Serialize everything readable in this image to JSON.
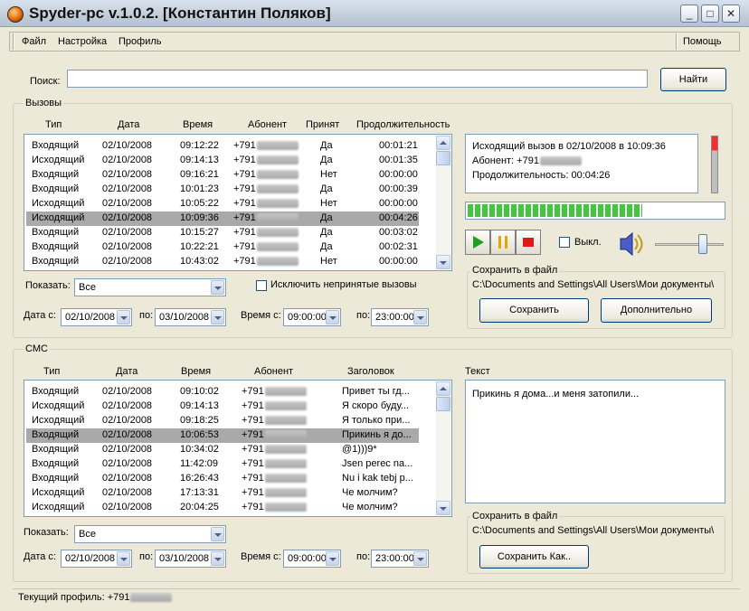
{
  "window": {
    "title": "Spyder-pc v.1.0.2. [Константин Поляков]",
    "minimize": "_",
    "maximize": "□",
    "close": "✕"
  },
  "menu": {
    "file": "Файл",
    "settings": "Настройка",
    "profile": "Профиль",
    "help": "Помощь"
  },
  "search": {
    "label": "Поиск:",
    "value": "",
    "button": "Найти"
  },
  "calls": {
    "group_title": "Вызовы",
    "headers": [
      "Тип",
      "Дата",
      "Время",
      "Абонент",
      "Принят",
      "Продолжительность"
    ],
    "rows": [
      [
        "Входящий",
        "02/10/2008",
        "09:12:22",
        "+791",
        "Да",
        "00:01:21"
      ],
      [
        "Исходящий",
        "02/10/2008",
        "09:14:13",
        "+791",
        "Да",
        "00:01:35"
      ],
      [
        "Входящий",
        "02/10/2008",
        "09:16:21",
        "+791",
        "Нет",
        "00:00:00"
      ],
      [
        "Входящий",
        "02/10/2008",
        "10:01:23",
        "+791",
        "Да",
        "00:00:39"
      ],
      [
        "Исходящий",
        "02/10/2008",
        "10:05:22",
        "+791",
        "Нет",
        "00:00:00"
      ],
      [
        "Исходящий",
        "02/10/2008",
        "10:09:36",
        "+791",
        "Да",
        "00:04:26"
      ],
      [
        "Входящий",
        "02/10/2008",
        "10:15:27",
        "+791",
        "Да",
        "00:03:02"
      ],
      [
        "Входящий",
        "02/10/2008",
        "10:22:21",
        "+791",
        "Да",
        "00:02:31"
      ],
      [
        "Входящий",
        "02/10/2008",
        "10:43:02",
        "+791",
        "Нет",
        "00:00:00"
      ]
    ],
    "selected_index": 5,
    "show_label": "Показать:",
    "show_value": "Все",
    "exclude_label": "Исключить непринятые вызовы",
    "date_from_label": "Дата с:",
    "date_from": "02/10/2008",
    "date_to_label": "по:",
    "date_to": "03/10/2008",
    "time_from_label": "Время с:",
    "time_from": "09:00:00",
    "time_to_label": "по:",
    "time_to": "23:00:00"
  },
  "call_info": {
    "line1": "Исходящий вызов в 02/10/2008 в 10:09:36",
    "line2": "Абонент: +791",
    "line3": "Продолжительность: 00:04:26"
  },
  "player": {
    "progress_fraction": 0.68,
    "volume_fraction": 0.72,
    "mute_label": "Выкл.",
    "save_group_title": "Сохранить в файл",
    "save_path": "C:\\Documents and Settings\\All Users\\Мои документы\\",
    "save_button": "Сохранить",
    "extra_button": "Дополнительно"
  },
  "sms": {
    "group_title": "СМС",
    "headers": [
      "Тип",
      "Дата",
      "Время",
      "Абонент",
      "Заголовок"
    ],
    "rows": [
      [
        "Входящий",
        "02/10/2008",
        "09:10:02",
        "+791",
        "Привет ты гд..."
      ],
      [
        "Исходящий",
        "02/10/2008",
        "09:14:13",
        "+791",
        "Я скоро буду..."
      ],
      [
        "Исходящий",
        "02/10/2008",
        "09:18:25",
        "+791",
        "Я только при..."
      ],
      [
        "Входящий",
        "02/10/2008",
        "10:06:53",
        "+791",
        "Прикинь я до..."
      ],
      [
        "Входящий",
        "02/10/2008",
        "10:34:02",
        "+791",
        "@1)))9*"
      ],
      [
        "Входящий",
        "02/10/2008",
        "11:42:09",
        "+791",
        "Jsen perec na..."
      ],
      [
        "Входящий",
        "02/10/2008",
        "16:26:43",
        "+791",
        "Nu i kak tebj p..."
      ],
      [
        "Исходящий",
        "02/10/2008",
        "17:13:31",
        "+791",
        "Че молчим?"
      ],
      [
        "Исходящий",
        "02/10/2008",
        "20:04:25",
        "+791",
        "Че молчим?"
      ]
    ],
    "selected_index": 3,
    "show_label": "Показать:",
    "show_value": "Все",
    "date_from_label": "Дата с:",
    "date_from": "02/10/2008",
    "date_to_label": "по:",
    "date_to": "03/10/2008",
    "time_from_label": "Время с:",
    "time_from": "09:00:00",
    "time_to_label": "по:",
    "time_to": "23:00:00",
    "text_label": "Текст",
    "text_value": "Прикинь я дома...и меня затопили...",
    "save_group_title": "Сохранить в файл",
    "save_path": "C:\\Documents and Settings\\All Users\\Мои документы\\",
    "save_as_button": "Сохранить Как.."
  },
  "status": {
    "profile": "Текущий профиль: +791"
  },
  "colors": {
    "selection": "#a9a9a9",
    "progress": "#42c63d",
    "play": "#1ea01e",
    "pause": "#e0a800",
    "stop": "#e01818"
  }
}
